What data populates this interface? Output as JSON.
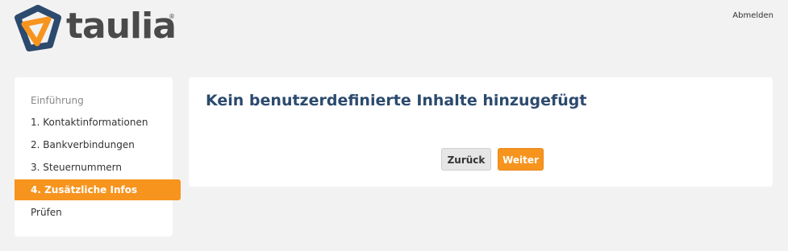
{
  "brand": {
    "name": "taulia",
    "registered": "®"
  },
  "header": {
    "signout_label": "Abmelden"
  },
  "sidebar": {
    "heading": "Einführung",
    "steps": [
      {
        "label": "1. Kontaktinformationen",
        "active": false
      },
      {
        "label": "2. Bankverbindungen",
        "active": false
      },
      {
        "label": "3. Steuernummern",
        "active": false
      },
      {
        "label": "4. Zusätzliche Infos",
        "active": true
      },
      {
        "label": "Prüfen",
        "active": false
      }
    ]
  },
  "main": {
    "title": "Kein benutzerdefinierte Inhalte hinzugefügt",
    "back_label": "Zurück",
    "next_label": "Weiter"
  },
  "colors": {
    "accent": "#f7941e",
    "title": "#2c4a6e",
    "logo_blue": "#2c4a6e",
    "background": "#f2f2f2"
  },
  "icons": {
    "logo": "taulia-logo-icon"
  }
}
